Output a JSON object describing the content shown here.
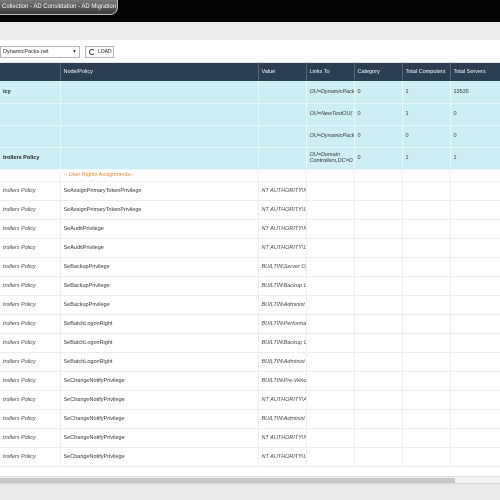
{
  "window": {
    "title": "Collection - AD Consildation - AD Migration"
  },
  "toolbar": {
    "domain_value": "DynamicPacks.net",
    "load_label": "LOAD"
  },
  "columns": [
    "",
    "Node/Policy",
    "Value",
    "Links To",
    "Category",
    "Total Computers",
    "Total Servers"
  ],
  "groups": [
    {
      "name": "icy",
      "links_to": "OU=DynamicPack",
      "category": "0",
      "computers": "1",
      "servers": "13535"
    },
    {
      "name": "",
      "links_to": "OU=NewTestOU(",
      "category": "0",
      "computers": "1",
      "servers": "0"
    },
    {
      "name": "",
      "links_to": "OU=DynamicPack",
      "category": "0",
      "computers": "0",
      "servers": "0"
    },
    {
      "name": "trollers Policy",
      "links_to": "OU=Domain Controllers,DC=D",
      "category": "0",
      "computers": "1",
      "servers": "1"
    }
  ],
  "section": {
    "title": "-- User Rights Assignments--"
  },
  "rows": [
    {
      "policy": "trollers Policy",
      "node": "SeAssignPrimaryTokenPrivilege",
      "value": "NT AUTHORITY\\NETV"
    },
    {
      "policy": "trollers Policy",
      "node": "SeAssignPrimaryTokenPrivilege",
      "value": "NT AUTHORITY\\LOCA"
    },
    {
      "policy": "trollers Policy",
      "node": "SeAuditPrivilege",
      "value": "NT AUTHORITY\\NETV"
    },
    {
      "policy": "trollers Policy",
      "node": "SeAuditPrivilege",
      "value": "NT AUTHORITY\\LOCA"
    },
    {
      "policy": "trollers Policy",
      "node": "SeBackupPrivilege",
      "value": "BUILTIN\\Server Operators"
    },
    {
      "policy": "trollers Policy",
      "node": "SeBackupPrivilege",
      "value": "BUILTIN\\Backup Operators"
    },
    {
      "policy": "trollers Policy",
      "node": "SeBackupPrivilege",
      "value": "BUILTIN\\Administ"
    },
    {
      "policy": "trollers Policy",
      "node": "SeBatchLogonRight",
      "value": "BUILTIN\\Performa Log Users"
    },
    {
      "policy": "trollers Policy",
      "node": "SeBatchLogonRight",
      "value": "BUILTIN\\Backup Operators"
    },
    {
      "policy": "trollers Policy",
      "node": "SeBatchLogonRight",
      "value": "BUILTIN\\Administ"
    },
    {
      "policy": "trollers Policy",
      "node": "SeChangeNotifyPrivilege",
      "value": "BUILTIN\\Pre-Wind 2000 Compatible"
    },
    {
      "policy": "trollers Policy",
      "node": "SeChangeNotifyPrivilege",
      "value": "NT AUTHORITY\\Auth"
    },
    {
      "policy": "trollers Policy",
      "node": "SeChangeNotifyPrivilege",
      "value": "BUILTIN\\Administ"
    },
    {
      "policy": "trollers Policy",
      "node": "SeChangeNotifyPrivilege",
      "value": "NT AUTHORITY\\NETV"
    },
    {
      "policy": "trollers Policy",
      "node": "SeChangeNotifyPrivilege",
      "value": "NT AUTHORITY\\LOCA"
    }
  ],
  "colors": {
    "header_bg": "#2c3e50",
    "group_bg": "#cdeef3",
    "section_title": "#e08a2b",
    "titlebar_bg": "#050505"
  }
}
